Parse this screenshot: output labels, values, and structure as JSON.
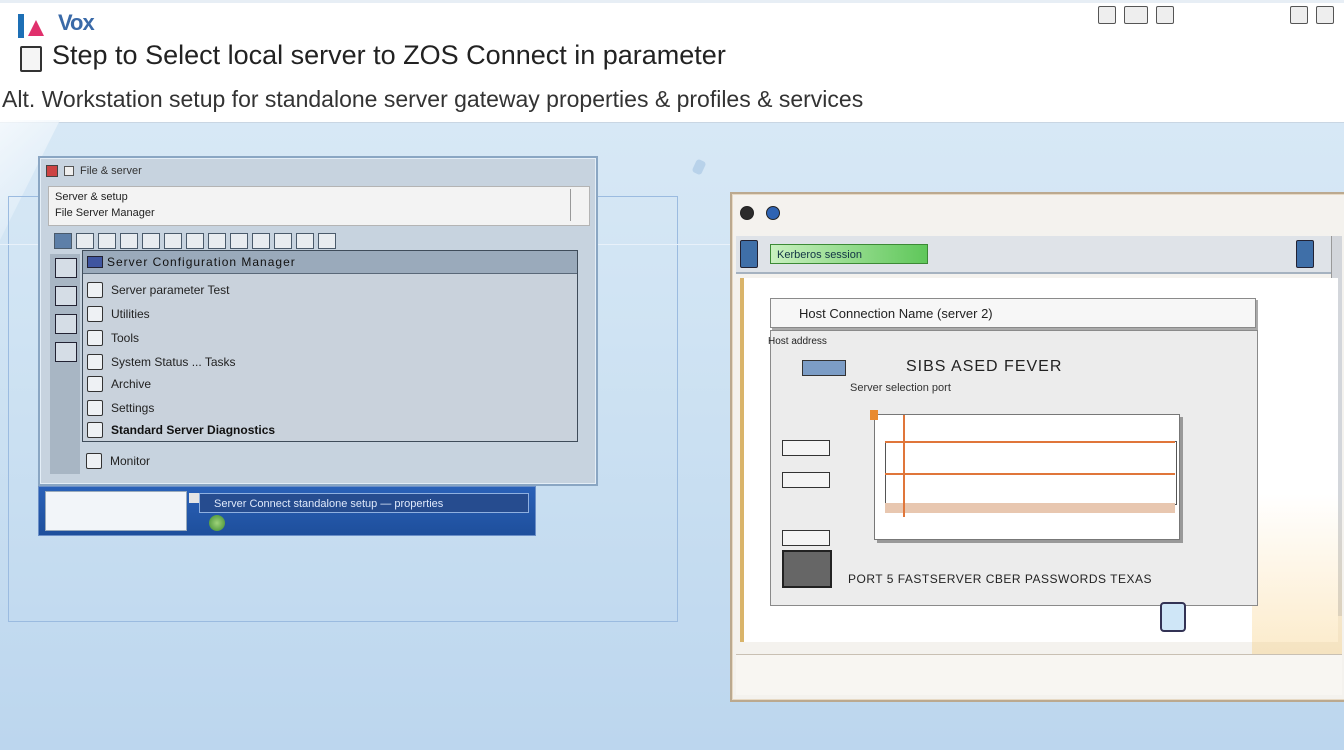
{
  "banner": {
    "brand": "Vox",
    "headline": "Step to Select local server to ZOS Connect in parameter",
    "subline": "Alt. Workstation setup for standalone server gateway properties & profiles & services"
  },
  "left_window": {
    "title": "File & server",
    "header_line1": "Server & setup",
    "header_line2": "File Server Manager",
    "selected_row": "Server Configuration Manager",
    "items": [
      {
        "label": "Server parameter Test"
      },
      {
        "label": "Utilities"
      },
      {
        "label": "Tools"
      },
      {
        "label": "System Status ... Tasks"
      },
      {
        "label": "Archive"
      },
      {
        "label": "Settings"
      },
      {
        "label": "Standard Server Diagnostics"
      },
      {
        "label": "Monitor"
      }
    ],
    "taskbar_label": "Server Connect standalone setup — properties"
  },
  "right_window": {
    "green_tab": "Kerberos session",
    "panel_title": "Host Connection Name (server 2)",
    "small_label": "Host address",
    "big_label": "SIBS ASED FEVER",
    "caption": "Server selection port",
    "footer": "PORT 5 FASTSERVER CBER PASSWORDS TEXAS"
  }
}
